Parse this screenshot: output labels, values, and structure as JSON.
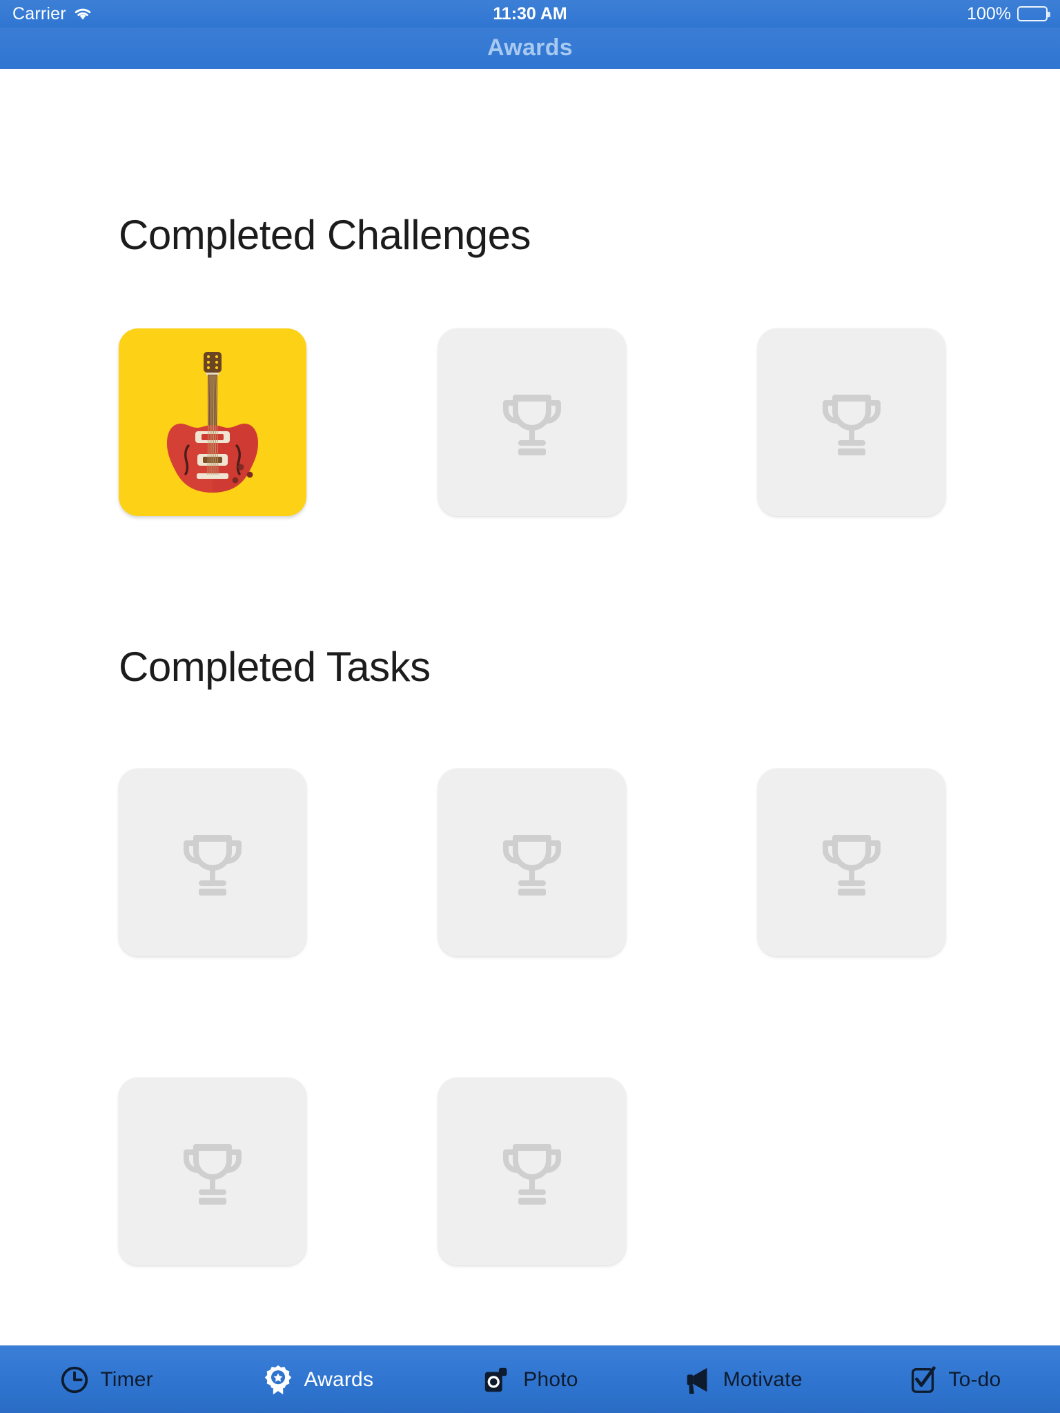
{
  "status_bar": {
    "carrier": "Carrier",
    "wifi_icon": "wifi-icon",
    "time": "11:30 AM",
    "battery_percent": "100%",
    "battery_icon": "battery-full-icon"
  },
  "nav_bar": {
    "title": "Awards",
    "title_color": "#a8c9f0",
    "background_color": "#2f76d2"
  },
  "sections": [
    {
      "id": "completed-challenges",
      "title": "Completed Challenges",
      "tiles": [
        {
          "state": "earned",
          "icon": "guitar-icon",
          "background_color": "#fcd116"
        },
        {
          "state": "empty",
          "icon": "trophy-icon",
          "background_color": "#efefef"
        },
        {
          "state": "empty",
          "icon": "trophy-icon",
          "background_color": "#efefef"
        }
      ]
    },
    {
      "id": "completed-tasks",
      "title": "Completed Tasks",
      "tiles": [
        {
          "state": "empty",
          "icon": "trophy-icon",
          "background_color": "#efefef"
        },
        {
          "state": "empty",
          "icon": "trophy-icon",
          "background_color": "#efefef"
        },
        {
          "state": "empty",
          "icon": "trophy-icon",
          "background_color": "#efefef"
        },
        {
          "state": "empty",
          "icon": "trophy-icon",
          "background_color": "#efefef"
        },
        {
          "state": "empty",
          "icon": "trophy-icon",
          "background_color": "#efefef"
        }
      ]
    }
  ],
  "tab_bar": {
    "background_color": "#2e74cf",
    "active_tab": "Awards",
    "tabs": [
      {
        "label": "Timer",
        "icon": "clock-icon",
        "active": false
      },
      {
        "label": "Awards",
        "icon": "award-badge-icon",
        "active": true
      },
      {
        "label": "Photo",
        "icon": "camera-icon",
        "active": false
      },
      {
        "label": "Motivate",
        "icon": "megaphone-icon",
        "active": false
      },
      {
        "label": "To-do",
        "icon": "checkbox-icon",
        "active": false
      }
    ]
  },
  "colors": {
    "accent_blue": "#2f76d2",
    "earned_yellow": "#fcd116",
    "empty_tile_gray": "#efefef",
    "trophy_gray": "#cfcfcf",
    "heading_black": "#1c1c1c",
    "inactive_tab": "#0e1b2e"
  }
}
